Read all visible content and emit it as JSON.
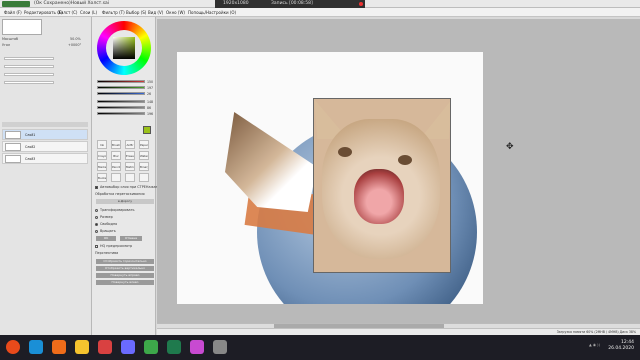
{
  "window": {
    "title": "(Ок Сохранено)Новый Холст.sai"
  },
  "recorder": {
    "resolution": "1920x1080",
    "status": "Запись [00:08:58]"
  },
  "menu": [
    "Файл (F)",
    "Редактировать (E)",
    "Холст (C)",
    "Слои (L)",
    "Фильтр (T)",
    "Выбор (S)",
    "Вид (V)",
    "Окно (W)",
    "Попощь/Настройки (O)"
  ],
  "toolbar_options": {
    "selection": "Выбрано",
    "zoom": "50%",
    "angle": "+000°",
    "antialiasing": "Сглаживание"
  },
  "left_panel": {
    "zoom_label": "Масштаб",
    "zoom_value": "50.0%",
    "angle_label": "Угол",
    "angle_value": "+0000°",
    "layers": [
      {
        "name": "Слой1",
        "selected": true
      },
      {
        "name": "Слой2",
        "selected": false
      },
      {
        "name": "Слой3",
        "selected": false
      }
    ]
  },
  "color_sliders": [
    {
      "value": "150",
      "color": "#d23c3c"
    },
    {
      "value": "197",
      "color": "#4ea42d"
    },
    {
      "value": "26",
      "color": "#3a6bd6"
    },
    {
      "value": "148",
      "color": "#8a8a8a"
    },
    {
      "value": "86",
      "color": "#8a8a8a"
    },
    {
      "value": "196",
      "color": "#8a8a8a"
    }
  ],
  "tools": [
    "Ink",
    "Brush",
    "AirBr",
    "Paper",
    "Crayon",
    "Blur",
    "Eraser",
    "Water",
    "Marker",
    "Pencil",
    "Matrix",
    "Binary",
    "Bucket",
    "",
    "",
    ""
  ],
  "transform_panel": {
    "auto_select": "Автовыбор слоя при СТРЕНажатии",
    "image_transform": "Обработка перетаскивания",
    "drag_btn": "в.Дорогу",
    "options": [
      {
        "label": "Трансформировать",
        "on": false
      },
      {
        "label": "Размер",
        "on": false
      },
      {
        "label": "Свободно",
        "on": true
      },
      {
        "label": "Вращать",
        "on": false
      }
    ],
    "ok": "OK",
    "cancel": "Отмена",
    "hq_preview": "HQ предпросмотр",
    "perspective": "Перспектива",
    "flip_h": "Отобразить горизонтально",
    "flip_v": "Отобразить вертикально",
    "rotate_cw": "Повернуть вправо",
    "rotate_ccw": "Повернуть влево"
  },
  "status": "Загрузка памяти 60% (2MHB / 4MHB)  Диск 38%",
  "taskbar": {
    "time": "12:44",
    "date": "26.04.2020",
    "icons": [
      "#e84a1b",
      "#1a8fd6",
      "#ef6c1a",
      "#f5c32e",
      "#d94141",
      "#6a6aff",
      "#3da84a",
      "#1f7a4d",
      "#c84ad1",
      "#888888"
    ]
  }
}
